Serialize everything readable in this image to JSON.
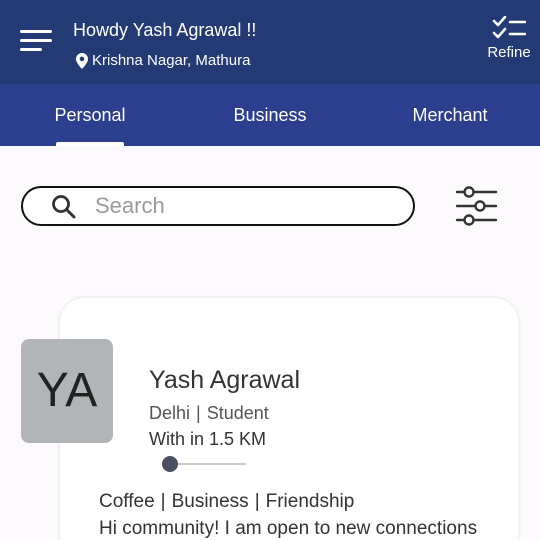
{
  "header": {
    "menu_icon": "hamburger-menu-icon",
    "greeting": "Howdy Yash Agrawal !!",
    "location_icon": "location-pin-icon",
    "location": "Krishna Nagar, Mathura",
    "refine_icon": "checklist-icon",
    "refine_label": "Refine",
    "bg_color": "#233a74"
  },
  "tabs": {
    "items": [
      {
        "label": "Personal",
        "active": true
      },
      {
        "label": "Business",
        "active": false
      },
      {
        "label": "Merchant",
        "active": false
      }
    ],
    "bg_color": "#2c3f8f"
  },
  "search": {
    "placeholder": "Search",
    "value": "",
    "icon": "search-icon",
    "filter_icon": "sliders-filter-icon"
  },
  "card": {
    "avatar_initials": "YA",
    "name": "Yash Agrawal",
    "city": "Delhi",
    "occupation": "Student",
    "distance": "With in 1.5 KM",
    "distance_level": 0,
    "interests": [
      "Coffee",
      "Business",
      "Friendship"
    ],
    "bio": "Hi community! I am open to new connections"
  }
}
